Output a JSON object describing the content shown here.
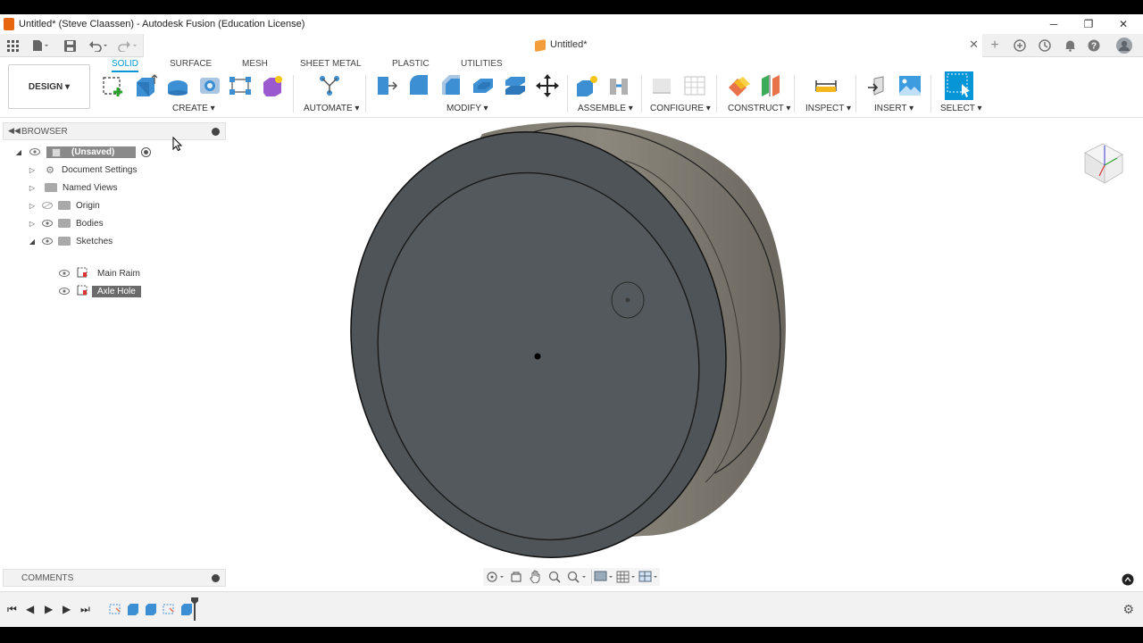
{
  "window": {
    "title": "Untitled* (Steve Claassen) - Autodesk Fusion (Education License)",
    "minimize": "─",
    "restore": "❐",
    "close": "✕"
  },
  "document_tab": {
    "title": "Untitled*",
    "close": "✕"
  },
  "workspace": {
    "label": "DESIGN ▾"
  },
  "ribbon_tabs": [
    {
      "label": "SOLID",
      "active": true
    },
    {
      "label": "SURFACE",
      "active": false
    },
    {
      "label": "MESH",
      "active": false
    },
    {
      "label": "SHEET METAL",
      "active": false
    },
    {
      "label": "PLASTIC",
      "active": false
    },
    {
      "label": "UTILITIES",
      "active": false
    }
  ],
  "ribbon_groups": {
    "create": "CREATE ▾",
    "automate": "AUTOMATE ▾",
    "modify": "MODIFY ▾",
    "assemble": "ASSEMBLE ▾",
    "configure": "CONFIGURE ▾",
    "construct": "CONSTRUCT ▾",
    "inspect": "INSPECT ▾",
    "insert": "INSERT ▾",
    "select": "SELECT ▾"
  },
  "browser": {
    "header": "BROWSER",
    "root": "(Unsaved)",
    "items": [
      {
        "label": "Document Settings"
      },
      {
        "label": "Named Views"
      },
      {
        "label": "Origin"
      },
      {
        "label": "Bodies"
      },
      {
        "label": "Sketches"
      }
    ],
    "sketches": [
      {
        "label": "Main Raim"
      },
      {
        "label": "Axle Hole"
      }
    ]
  },
  "comments": {
    "header": "COMMENTS"
  },
  "colors": {
    "accent": "#0696d7",
    "body_face": "#4f5558",
    "body_rim": "#8c877c",
    "selection": "#0696d7"
  },
  "viewcube_icon": "viewcube-icon"
}
